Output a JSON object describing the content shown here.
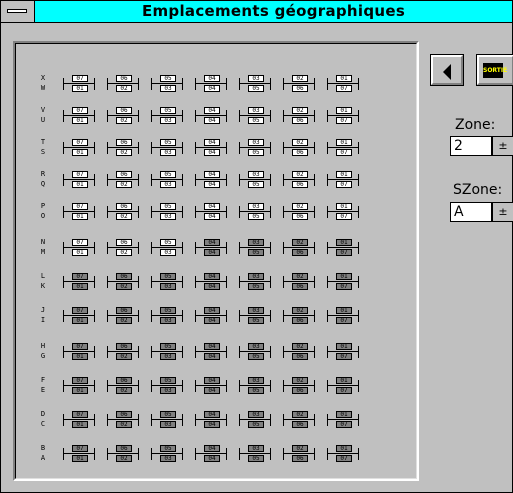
{
  "window": {
    "title": "Emplacements géographiques"
  },
  "grid": {
    "rows": [
      {
        "top": "X",
        "bottom": "W",
        "dark_cells": []
      },
      {
        "top": "V",
        "bottom": "U",
        "dark_cells": []
      },
      {
        "top": "T",
        "bottom": "S",
        "dark_cells": []
      },
      {
        "top": "R",
        "bottom": "Q",
        "dark_cells": []
      },
      {
        "top": "P",
        "bottom": "O",
        "dark_cells": []
      },
      {
        "top": "N",
        "bottom": "M",
        "dark_cells": [
          3,
          4,
          5,
          6
        ]
      },
      {
        "top": "L",
        "bottom": "K",
        "dark_cells": [
          0,
          1,
          2,
          3,
          4,
          5,
          6
        ]
      },
      {
        "top": "J",
        "bottom": "I",
        "dark_cells": [
          0,
          1,
          2,
          3,
          4,
          5,
          6
        ]
      },
      {
        "top": "H",
        "bottom": "G",
        "dark_cells": [
          0,
          1,
          2,
          3,
          4,
          5,
          6
        ]
      },
      {
        "top": "F",
        "bottom": "E",
        "dark_cells": [
          0,
          1,
          2,
          3,
          4,
          5,
          6
        ]
      },
      {
        "top": "D",
        "bottom": "C",
        "dark_cells": [
          0,
          1,
          2,
          3,
          4,
          5,
          6
        ]
      },
      {
        "top": "B",
        "bottom": "A",
        "dark_cells": [
          0,
          1,
          2,
          3,
          4,
          5,
          6
        ]
      }
    ],
    "top_numbers": [
      "07",
      "06",
      "05",
      "04",
      "03",
      "02",
      "01"
    ],
    "bottom_numbers": [
      "01",
      "02",
      "03",
      "04",
      "05",
      "06",
      "07"
    ]
  },
  "controls": {
    "back_button": {
      "icon": "left-arrow-icon"
    },
    "sortie_button": {
      "label": "SORTIE"
    },
    "zone": {
      "label": "Zone:",
      "value": "2"
    },
    "szone": {
      "label": "SZone:",
      "value": "A"
    },
    "spin_glyph": "±"
  }
}
